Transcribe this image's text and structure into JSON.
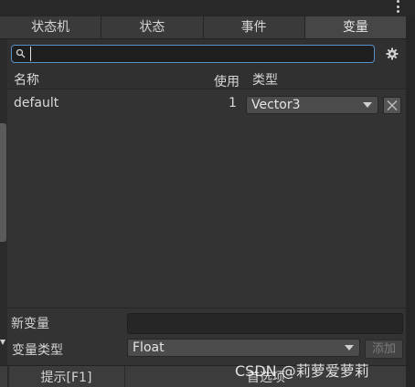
{
  "tabs": [
    {
      "label": "状态机"
    },
    {
      "label": "状态"
    },
    {
      "label": "事件"
    },
    {
      "label": "变量"
    }
  ],
  "active_tab": "变量",
  "search": {
    "value": "",
    "placeholder": ""
  },
  "table": {
    "headers": {
      "name": "名称",
      "use": "使用",
      "type": "类型"
    },
    "rows": [
      {
        "name": "default",
        "count": "1",
        "type": "Vector3"
      }
    ]
  },
  "form": {
    "new_variable_label": "新变量",
    "new_variable_value": "",
    "variable_type_label": "变量类型",
    "variable_type_value": "Float",
    "add_label": "添加"
  },
  "bottom": {
    "hint_label": "提示[F1]",
    "prefs_label": "首选项"
  },
  "watermark": "CSDN @莉萝爱萝莉",
  "colors": {
    "accent_focus": "#5a8ec9",
    "panel_bg": "#333333",
    "tab_active_bg": "#464646"
  },
  "icons": {
    "menu": "kebab-menu-icon",
    "search": "search-icon",
    "settings": "gear-icon",
    "delete": "close-icon",
    "dropdown": "chevron-down-icon"
  }
}
